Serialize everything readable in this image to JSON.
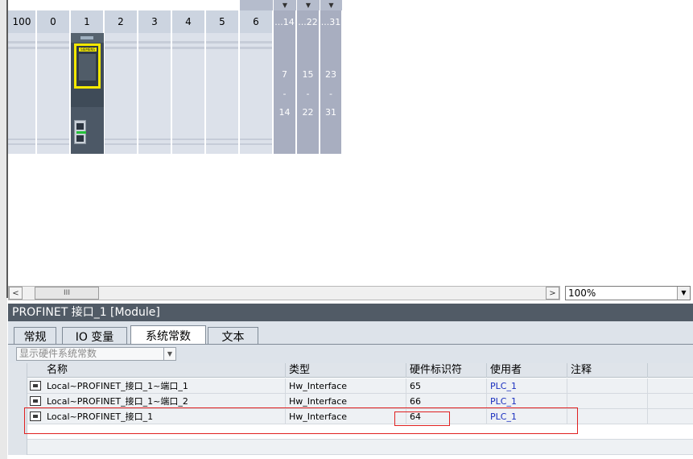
{
  "rack": {
    "slots": [
      "100",
      "0",
      "1",
      "2",
      "3",
      "4",
      "5",
      "6"
    ],
    "expansion_headers": [
      "...14",
      "...22",
      "...31"
    ],
    "expansion_columns": [
      {
        "top": "7",
        "dash": "-",
        "bottom": "14"
      },
      {
        "top": "15",
        "dash": "-",
        "bottom": "22"
      },
      {
        "top": "23",
        "dash": "-",
        "bottom": "31"
      }
    ],
    "module_logo": "SIEMENS"
  },
  "scrollbar": {
    "left_arrow": "<",
    "thumb_grip": "III",
    "right_arrow": ">"
  },
  "zoom": {
    "value": "100%"
  },
  "panel": {
    "title": "PROFINET 接口_1 [Module]",
    "tabs": [
      "常规",
      "IO 变量",
      "系统常数",
      "文本"
    ],
    "active_tab": "系统常数",
    "filter_placeholder": "显示硬件系统常数"
  },
  "table": {
    "columns": [
      "名称",
      "类型",
      "硬件标识符",
      "使用者",
      "注释"
    ],
    "rows": [
      {
        "name": "Local~PROFINET_接口_1~端口_1",
        "type": "Hw_Interface",
        "hw_id": "65",
        "user": "PLC_1",
        "comment": ""
      },
      {
        "name": "Local~PROFINET_接口_1~端口_2",
        "type": "Hw_Interface",
        "hw_id": "66",
        "user": "PLC_1",
        "comment": ""
      },
      {
        "name": "Local~PROFINET_接口_1",
        "type": "Hw_Interface",
        "hw_id": "64",
        "user": "PLC_1",
        "comment": ""
      }
    ]
  },
  "colors": {
    "panel_title_bg": "#515b66",
    "highlight": "#e02020",
    "user_link": "#1a2fbf"
  }
}
